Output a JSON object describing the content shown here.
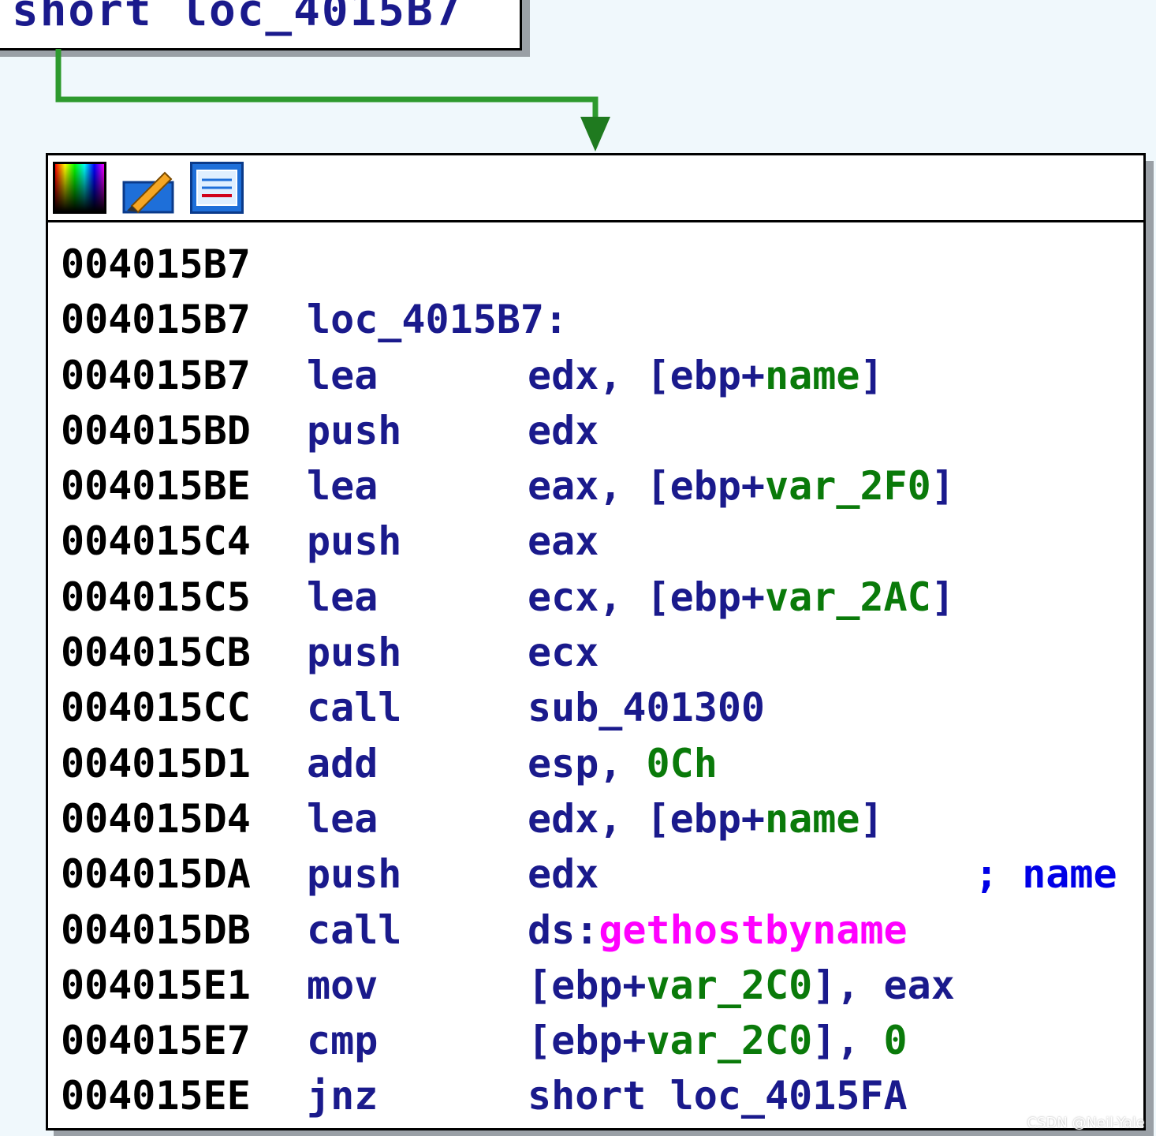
{
  "prev_block": {
    "text": "short loc_4015B7"
  },
  "edge_color": "#2e9a2e",
  "node": {
    "toolbar": {
      "buttons": [
        {
          "name": "color-picker-icon"
        },
        {
          "name": "edit-pencil-icon"
        },
        {
          "name": "graph-overview-icon"
        }
      ]
    },
    "lines": [
      {
        "addr": "004015B7",
        "mnem": "",
        "ops": ""
      },
      {
        "addr": "004015B7",
        "mnem": "loc_4015B7:",
        "ops": ""
      },
      {
        "addr": "004015B7",
        "mnem": "lea",
        "ops_a": "edx, [ebp+",
        "ops_v": "name",
        "ops_b": "]"
      },
      {
        "addr": "004015BD",
        "mnem": "push",
        "ops": "edx"
      },
      {
        "addr": "004015BE",
        "mnem": "lea",
        "ops_a": "eax, [ebp+",
        "ops_v": "var_2F0",
        "ops_b": "]"
      },
      {
        "addr": "004015C4",
        "mnem": "push",
        "ops": "eax"
      },
      {
        "addr": "004015C5",
        "mnem": "lea",
        "ops_a": "ecx, [ebp+",
        "ops_v": "var_2AC",
        "ops_b": "]"
      },
      {
        "addr": "004015CB",
        "mnem": "push",
        "ops": "ecx"
      },
      {
        "addr": "004015CC",
        "mnem": "call",
        "ops": "sub_401300"
      },
      {
        "addr": "004015D1",
        "mnem": "add",
        "ops_a": "esp, ",
        "ops_n": "0Ch"
      },
      {
        "addr": "004015D4",
        "mnem": "lea",
        "ops_a": "edx, [ebp+",
        "ops_v": "name",
        "ops_b": "]"
      },
      {
        "addr": "004015DA",
        "mnem": "push",
        "ops": "edx",
        "comment": "; name"
      },
      {
        "addr": "004015DB",
        "mnem": "call",
        "ops_a": "ds:",
        "ops_i": "gethostbyname"
      },
      {
        "addr": "004015E1",
        "mnem": "mov",
        "ops_a": "[ebp+",
        "ops_v": "var_2C0",
        "ops_b": "], eax"
      },
      {
        "addr": "004015E7",
        "mnem": "cmp",
        "ops_a": "[ebp+",
        "ops_v": "var_2C0",
        "ops_b": "], ",
        "ops_n": "0"
      },
      {
        "addr": "004015EE",
        "mnem": "jnz",
        "ops": "short loc_4015FA"
      }
    ]
  },
  "watermark": "CSDN @Neil-Yale"
}
